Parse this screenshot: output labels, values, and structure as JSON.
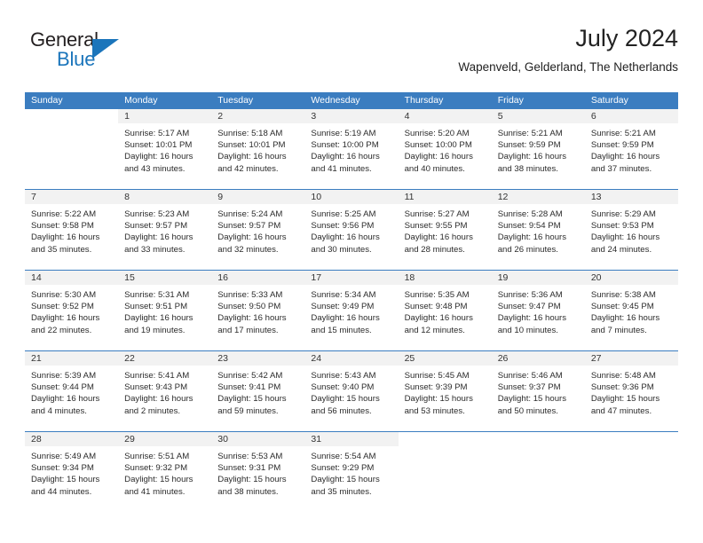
{
  "brand": {
    "name_top": "General",
    "name_bottom": "Blue",
    "triangle_icon": "blue-triangle",
    "accent_color": "#1b75bb"
  },
  "header": {
    "title": "July 2024",
    "subtitle": "Wapenveld, Gelderland, The Netherlands"
  },
  "theme": {
    "header_blue": "#3b7dc0",
    "daynum_band": "#f2f2f2",
    "text": "#222222"
  },
  "weekdays": [
    "Sunday",
    "Monday",
    "Tuesday",
    "Wednesday",
    "Thursday",
    "Friday",
    "Saturday"
  ],
  "weeks": [
    [
      {
        "day": "",
        "sunrise": "",
        "sunset": "",
        "daylight": "",
        "blank": true
      },
      {
        "day": "1",
        "sunrise": "Sunrise: 5:17 AM",
        "sunset": "Sunset: 10:01 PM",
        "daylight": "Daylight: 16 hours and 43 minutes."
      },
      {
        "day": "2",
        "sunrise": "Sunrise: 5:18 AM",
        "sunset": "Sunset: 10:01 PM",
        "daylight": "Daylight: 16 hours and 42 minutes."
      },
      {
        "day": "3",
        "sunrise": "Sunrise: 5:19 AM",
        "sunset": "Sunset: 10:00 PM",
        "daylight": "Daylight: 16 hours and 41 minutes."
      },
      {
        "day": "4",
        "sunrise": "Sunrise: 5:20 AM",
        "sunset": "Sunset: 10:00 PM",
        "daylight": "Daylight: 16 hours and 40 minutes."
      },
      {
        "day": "5",
        "sunrise": "Sunrise: 5:21 AM",
        "sunset": "Sunset: 9:59 PM",
        "daylight": "Daylight: 16 hours and 38 minutes."
      },
      {
        "day": "6",
        "sunrise": "Sunrise: 5:21 AM",
        "sunset": "Sunset: 9:59 PM",
        "daylight": "Daylight: 16 hours and 37 minutes."
      }
    ],
    [
      {
        "day": "7",
        "sunrise": "Sunrise: 5:22 AM",
        "sunset": "Sunset: 9:58 PM",
        "daylight": "Daylight: 16 hours and 35 minutes."
      },
      {
        "day": "8",
        "sunrise": "Sunrise: 5:23 AM",
        "sunset": "Sunset: 9:57 PM",
        "daylight": "Daylight: 16 hours and 33 minutes."
      },
      {
        "day": "9",
        "sunrise": "Sunrise: 5:24 AM",
        "sunset": "Sunset: 9:57 PM",
        "daylight": "Daylight: 16 hours and 32 minutes."
      },
      {
        "day": "10",
        "sunrise": "Sunrise: 5:25 AM",
        "sunset": "Sunset: 9:56 PM",
        "daylight": "Daylight: 16 hours and 30 minutes."
      },
      {
        "day": "11",
        "sunrise": "Sunrise: 5:27 AM",
        "sunset": "Sunset: 9:55 PM",
        "daylight": "Daylight: 16 hours and 28 minutes."
      },
      {
        "day": "12",
        "sunrise": "Sunrise: 5:28 AM",
        "sunset": "Sunset: 9:54 PM",
        "daylight": "Daylight: 16 hours and 26 minutes."
      },
      {
        "day": "13",
        "sunrise": "Sunrise: 5:29 AM",
        "sunset": "Sunset: 9:53 PM",
        "daylight": "Daylight: 16 hours and 24 minutes."
      }
    ],
    [
      {
        "day": "14",
        "sunrise": "Sunrise: 5:30 AM",
        "sunset": "Sunset: 9:52 PM",
        "daylight": "Daylight: 16 hours and 22 minutes."
      },
      {
        "day": "15",
        "sunrise": "Sunrise: 5:31 AM",
        "sunset": "Sunset: 9:51 PM",
        "daylight": "Daylight: 16 hours and 19 minutes."
      },
      {
        "day": "16",
        "sunrise": "Sunrise: 5:33 AM",
        "sunset": "Sunset: 9:50 PM",
        "daylight": "Daylight: 16 hours and 17 minutes."
      },
      {
        "day": "17",
        "sunrise": "Sunrise: 5:34 AM",
        "sunset": "Sunset: 9:49 PM",
        "daylight": "Daylight: 16 hours and 15 minutes."
      },
      {
        "day": "18",
        "sunrise": "Sunrise: 5:35 AM",
        "sunset": "Sunset: 9:48 PM",
        "daylight": "Daylight: 16 hours and 12 minutes."
      },
      {
        "day": "19",
        "sunrise": "Sunrise: 5:36 AM",
        "sunset": "Sunset: 9:47 PM",
        "daylight": "Daylight: 16 hours and 10 minutes."
      },
      {
        "day": "20",
        "sunrise": "Sunrise: 5:38 AM",
        "sunset": "Sunset: 9:45 PM",
        "daylight": "Daylight: 16 hours and 7 minutes."
      }
    ],
    [
      {
        "day": "21",
        "sunrise": "Sunrise: 5:39 AM",
        "sunset": "Sunset: 9:44 PM",
        "daylight": "Daylight: 16 hours and 4 minutes."
      },
      {
        "day": "22",
        "sunrise": "Sunrise: 5:41 AM",
        "sunset": "Sunset: 9:43 PM",
        "daylight": "Daylight: 16 hours and 2 minutes."
      },
      {
        "day": "23",
        "sunrise": "Sunrise: 5:42 AM",
        "sunset": "Sunset: 9:41 PM",
        "daylight": "Daylight: 15 hours and 59 minutes."
      },
      {
        "day": "24",
        "sunrise": "Sunrise: 5:43 AM",
        "sunset": "Sunset: 9:40 PM",
        "daylight": "Daylight: 15 hours and 56 minutes."
      },
      {
        "day": "25",
        "sunrise": "Sunrise: 5:45 AM",
        "sunset": "Sunset: 9:39 PM",
        "daylight": "Daylight: 15 hours and 53 minutes."
      },
      {
        "day": "26",
        "sunrise": "Sunrise: 5:46 AM",
        "sunset": "Sunset: 9:37 PM",
        "daylight": "Daylight: 15 hours and 50 minutes."
      },
      {
        "day": "27",
        "sunrise": "Sunrise: 5:48 AM",
        "sunset": "Sunset: 9:36 PM",
        "daylight": "Daylight: 15 hours and 47 minutes."
      }
    ],
    [
      {
        "day": "28",
        "sunrise": "Sunrise: 5:49 AM",
        "sunset": "Sunset: 9:34 PM",
        "daylight": "Daylight: 15 hours and 44 minutes."
      },
      {
        "day": "29",
        "sunrise": "Sunrise: 5:51 AM",
        "sunset": "Sunset: 9:32 PM",
        "daylight": "Daylight: 15 hours and 41 minutes."
      },
      {
        "day": "30",
        "sunrise": "Sunrise: 5:53 AM",
        "sunset": "Sunset: 9:31 PM",
        "daylight": "Daylight: 15 hours and 38 minutes."
      },
      {
        "day": "31",
        "sunrise": "Sunrise: 5:54 AM",
        "sunset": "Sunset: 9:29 PM",
        "daylight": "Daylight: 15 hours and 35 minutes."
      },
      {
        "day": "",
        "sunrise": "",
        "sunset": "",
        "daylight": "",
        "blank": true
      },
      {
        "day": "",
        "sunrise": "",
        "sunset": "",
        "daylight": "",
        "blank": true
      },
      {
        "day": "",
        "sunrise": "",
        "sunset": "",
        "daylight": "",
        "blank": true
      }
    ]
  ]
}
